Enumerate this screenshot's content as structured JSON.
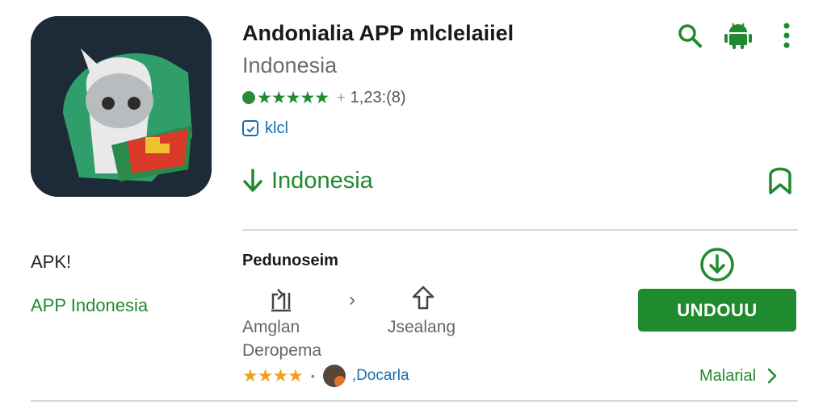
{
  "app": {
    "title": "Andonialia APP mlclelaiiel",
    "subtitle": "Indonesia",
    "rating_count": "1,23:(8)",
    "rating_separator": "+",
    "meta_label": "klcl",
    "install_label": "Indonesia"
  },
  "left_panel": {
    "apk_label": "APK!",
    "apk_sub": "APP Indonesia"
  },
  "details": {
    "section_title": "Pedunoseim",
    "label_a": "Amglan",
    "label_b": "Deropema",
    "label_c": "Jsealang",
    "reviewer": ",Docarla",
    "review_stars_text": "★★★★",
    "rating_stars_text": "★★★★★"
  },
  "actions": {
    "download_button": "UNDOUU",
    "more_link": "Malarial"
  },
  "colors": {
    "brand_green": "#1f8a2e",
    "link_blue": "#1a6fb0",
    "star_orange": "#f0a020",
    "icon_bg": "#1d2a38"
  },
  "icons": {
    "top": [
      "search-icon",
      "android-icon",
      "more-vert-icon"
    ],
    "bookmark": "bookmark-icon",
    "install": "arrow-down-icon",
    "share": "share-icon",
    "upload": "upload-icon",
    "download_circle": "download-circle-icon",
    "chevron": "chevron-right-icon"
  }
}
